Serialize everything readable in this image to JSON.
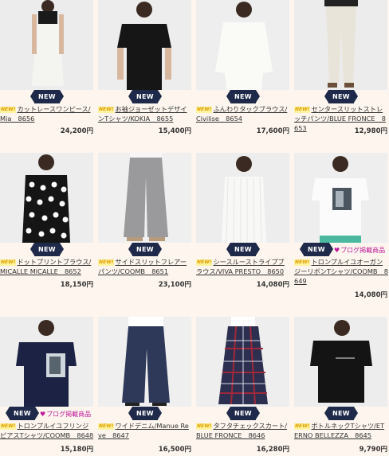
{
  "new_label": "NEW",
  "new_mark": "NEW!",
  "blog_label": "ブログ掲載商品",
  "products": [
    {
      "title": "カットレースワンピース/Mia　8656",
      "price": "24,200円",
      "blog": false
    },
    {
      "title": "お袖ジョーゼットデザインTシャツ/KOKIA　8655",
      "price": "15,400円",
      "blog": false
    },
    {
      "title": "ふんわりタックブラウス/Civilise　8654",
      "price": "17,600円",
      "blog": false
    },
    {
      "title": "センタースリットストレッチパンツ/BLUE FRONCE　8653",
      "price": "12,980円",
      "blog": false
    },
    {
      "title": "ドットプリントブラウス/MICALLE MICALLE　8652",
      "price": "18,150円",
      "blog": false
    },
    {
      "title": "サイドスリットフレアーパンツ/COOMB　8651",
      "price": "23,100円",
      "blog": false
    },
    {
      "title": "シースルーストライプブラウス/VIVA PRESTO　8650",
      "price": "14,080円",
      "blog": false
    },
    {
      "title": "トロンプルイユオーガンジーリボンTシャツ/COOMB　8649",
      "price": "14,080円",
      "blog": true
    },
    {
      "title": "トロンプルイユフリンジピアスTシャツ/COOMB　8648",
      "price": "15,180円",
      "blog": true
    },
    {
      "title": "ワイドデニム/Manue Reve　8647",
      "price": "16,500円",
      "blog": false
    },
    {
      "title": "タフタチェックスカート/BLUE FRONCE　8646",
      "price": "16,280円",
      "blog": false
    },
    {
      "title": "ボトルネックTシャツ/ETERNO BELLEZZA　8645",
      "price": "9,790円",
      "blog": false
    }
  ],
  "colors": {
    "ribbon": "#1f2a4a",
    "blog_text": "#c0189a",
    "row_tint": "#fdf5ee"
  }
}
